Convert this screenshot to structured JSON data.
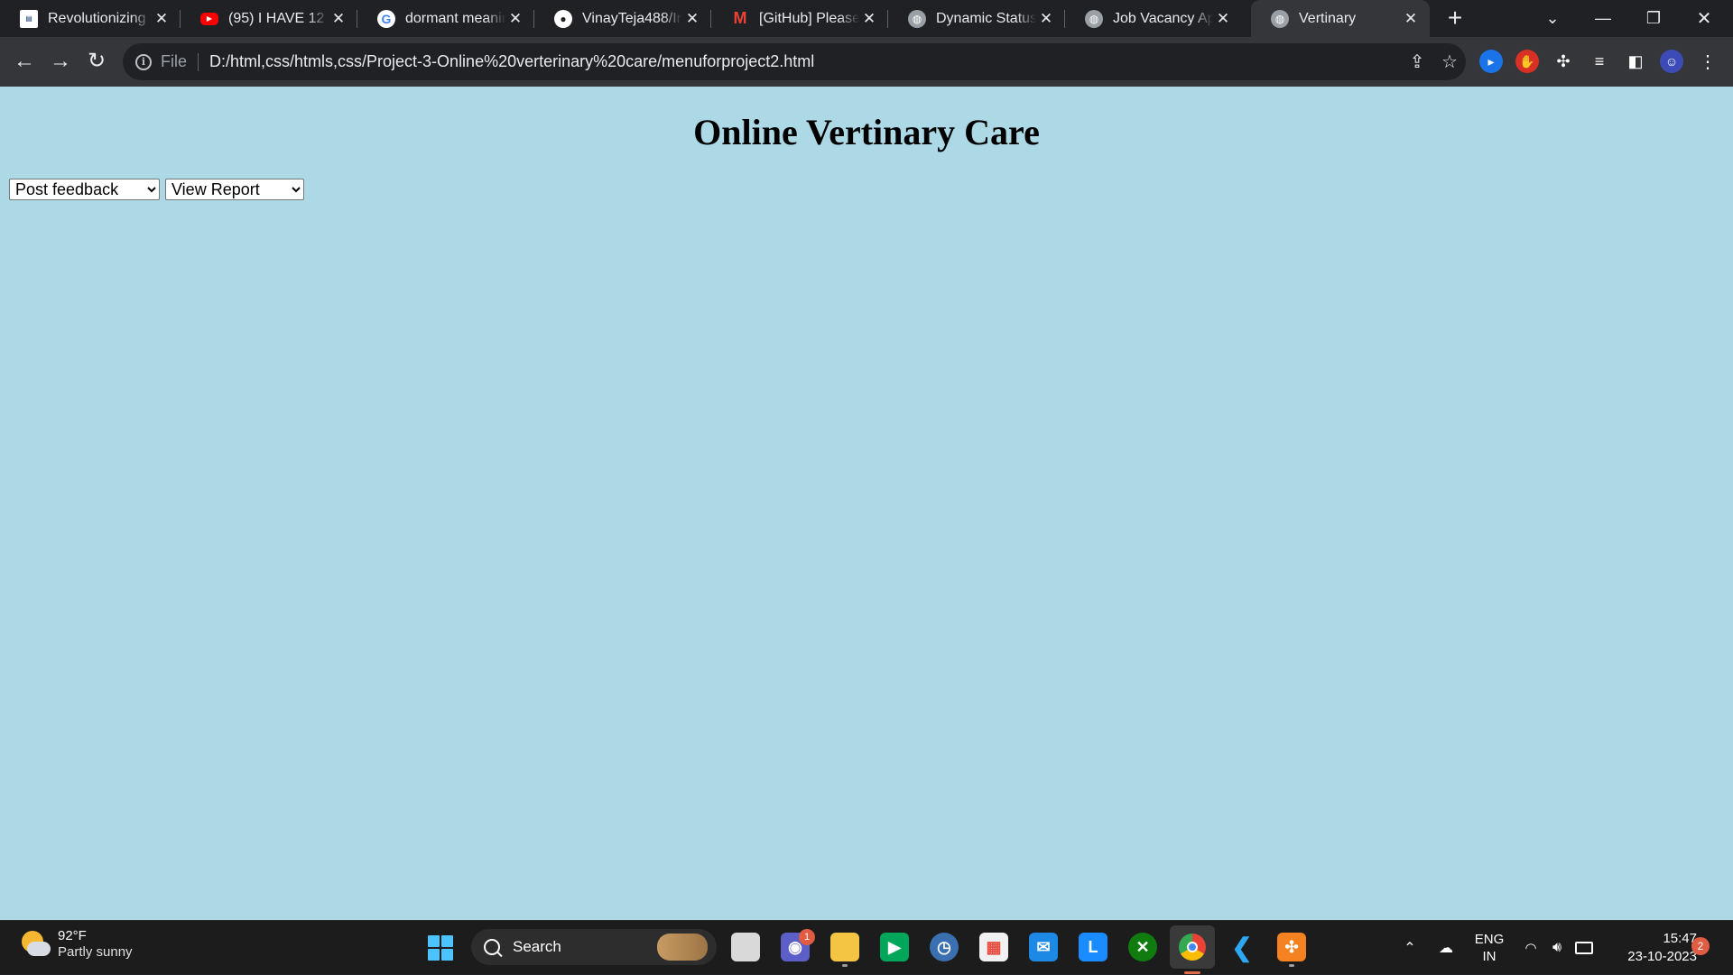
{
  "browser": {
    "tabs": [
      {
        "title": "Revolutionizing t",
        "icon": "news-icon",
        "active": false
      },
      {
        "title": "(95) I HAVE 12 M",
        "icon": "youtube-icon",
        "active": false
      },
      {
        "title": "dormant meanin",
        "icon": "google-icon",
        "active": false
      },
      {
        "title": "VinayTeja488/Int",
        "icon": "github-icon",
        "active": false
      },
      {
        "title": "[GitHub] Please v",
        "icon": "gmail-icon",
        "active": false
      },
      {
        "title": "Dynamic Status U",
        "icon": "globe-icon",
        "active": false
      },
      {
        "title": "Job Vacancy App",
        "icon": "globe-icon",
        "active": false
      },
      {
        "title": "Vertinary",
        "icon": "globe-icon",
        "active": true
      }
    ],
    "address": {
      "scheme_label": "File",
      "url": "D:/html,css/htmls,css/Project-3-Online%20verterinary%20care/menuforproject2.html"
    }
  },
  "page": {
    "heading": "Online Vertinary Care",
    "menus": [
      {
        "selected": "Post feedback"
      },
      {
        "selected": "View Report"
      }
    ]
  },
  "taskbar": {
    "weather": {
      "temp": "92°F",
      "condition": "Partly sunny"
    },
    "search_label": "Search",
    "teams_badge": "1",
    "language": {
      "line1": "ENG",
      "line2": "IN"
    },
    "clock": {
      "time": "15:47",
      "date": "23-10-2023"
    },
    "notifications": "2"
  },
  "colors": {
    "page_background": "#add8e6",
    "browser_frame": "#202124",
    "toolbar": "#35363a",
    "taskbar": "#1c1c1c"
  }
}
